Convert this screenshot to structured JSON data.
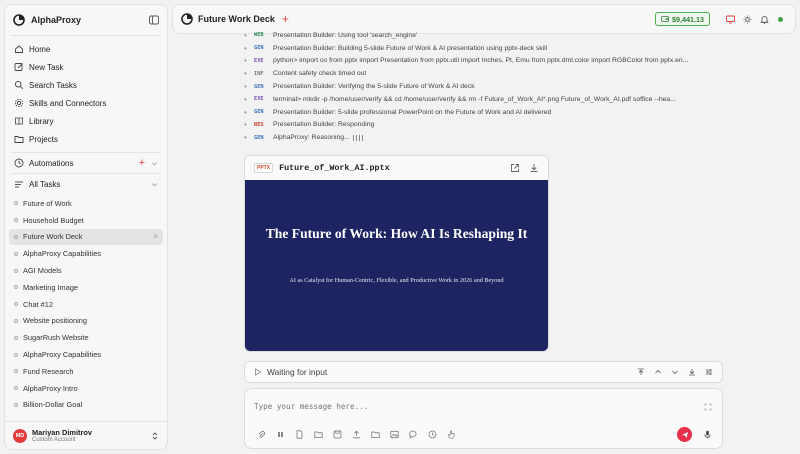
{
  "app": {
    "brand": "AlphaProxy"
  },
  "sidebar": {
    "nav": [
      {
        "label": "Home",
        "icon": "home-icon"
      },
      {
        "label": "New Task",
        "icon": "edit-icon"
      },
      {
        "label": "Search Tasks",
        "icon": "search-icon"
      },
      {
        "label": "Skills and Connectors",
        "icon": "gear-icon"
      },
      {
        "label": "Library",
        "icon": "book-icon"
      },
      {
        "label": "Projects",
        "icon": "folder-icon"
      }
    ],
    "automations_label": "Automations",
    "all_tasks_label": "All Tasks",
    "tasks": [
      "Future of Work",
      "Household Budget",
      "Future Work Deck",
      "AlphaProxy Capabilities",
      "AGI Models",
      "Marketing Image",
      "Chat #12",
      "Website positioning",
      "SugarRush Website",
      "AlphaProxy Capabilities",
      "Fund Research",
      "AlphaProxy Intro",
      "Billion-Dollar Goal"
    ],
    "active_task_index": 2,
    "user": {
      "initials": "MD",
      "name": "Mariyan Dimitrov",
      "account": "Custom Account"
    }
  },
  "topbar": {
    "title": "Future Work Deck",
    "balance": "$9,441.13"
  },
  "log": [
    {
      "tag": "WEB",
      "text": "Presentation Builder: Using tool 'search_engine'"
    },
    {
      "tag": "GEN",
      "text": "Presentation Builder: Building 5-slide Future of Work & AI presentation using pptx-deck skill"
    },
    {
      "tag": "EXE",
      "text": "python> import os from pptx import Presentation from pptx.util import Inches, Pt, Emu from pptx.dml.color import RGBColor from pptx.en..."
    },
    {
      "tag": "INF",
      "text": "Content safety check timed out"
    },
    {
      "tag": "GEN",
      "text": "Presentation Builder: Verifying the 5-slide Future of Work & AI deck"
    },
    {
      "tag": "EXE",
      "text": "terminal> mkdir -p /home/user/verify && cd /home/user/verify && rm -f Future_of_Work_AI*.png Future_of_Work_AI.pdf soffice --hea..."
    },
    {
      "tag": "GEN",
      "text": "Presentation Builder: 5-slide professional PowerPoint on the Future of Work and AI delivered"
    },
    {
      "tag": "RES",
      "text": "Presentation Builder: Responding"
    },
    {
      "tag": "GEN",
      "text": "AlphaProxy: Reasoning..."
    }
  ],
  "file_card": {
    "badge": "PPTX",
    "filename": "Future_of_Work_AI.pptx",
    "slide_title": "The Future of Work: How AI Is Reshaping It",
    "slide_subtitle": "AI as Catalyst for Human-Centric, Flexible, and Productive Work in 2026 and Beyond",
    "slide_bg": "#1e2461"
  },
  "status": {
    "text": "Waiting for input"
  },
  "composer": {
    "placeholder": "Type your message here..."
  },
  "colors": {
    "accent": "#e03e3e",
    "balance": "#2e7d32",
    "send": "#e5304a"
  }
}
